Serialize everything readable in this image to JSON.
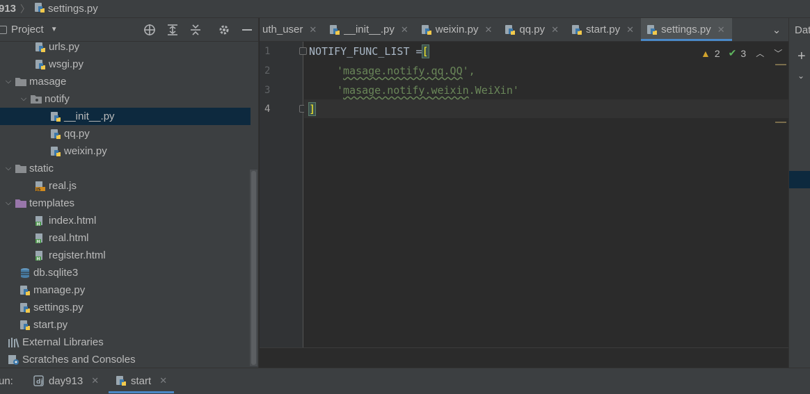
{
  "breadcrumb": {
    "root": "913",
    "file": "settings.py"
  },
  "project_panel": {
    "title": "Project",
    "tools": [
      "locate-icon",
      "expand-all-icon",
      "collapse-all-icon",
      "gear-icon",
      "minimize-icon"
    ]
  },
  "tree": [
    {
      "label": "urls.py",
      "icon": "python-file",
      "depth": 2,
      "expanded": null
    },
    {
      "label": "wsgi.py",
      "icon": "python-file",
      "depth": 2,
      "expanded": null
    },
    {
      "label": "masage",
      "icon": "folder",
      "depth": 1,
      "expanded": true
    },
    {
      "label": "notify",
      "icon": "package-folder",
      "depth": 2,
      "expanded": true
    },
    {
      "label": "__init__.py",
      "icon": "python-file",
      "depth": 3,
      "expanded": null,
      "selected": true
    },
    {
      "label": "qq.py",
      "icon": "python-file",
      "depth": 3,
      "expanded": null
    },
    {
      "label": "weixin.py",
      "icon": "python-file",
      "depth": 3,
      "expanded": null
    },
    {
      "label": "static",
      "icon": "folder",
      "depth": 1,
      "expanded": true
    },
    {
      "label": "real.js",
      "icon": "js-file",
      "depth": 2,
      "expanded": null
    },
    {
      "label": "templates",
      "icon": "template-folder",
      "depth": 1,
      "expanded": true
    },
    {
      "label": "index.html",
      "icon": "html-file",
      "depth": 2,
      "expanded": null
    },
    {
      "label": "real.html",
      "icon": "html-file",
      "depth": 2,
      "expanded": null
    },
    {
      "label": "register.html",
      "icon": "html-file",
      "depth": 2,
      "expanded": null
    },
    {
      "label": "db.sqlite3",
      "icon": "database",
      "depth": 1,
      "expanded": null
    },
    {
      "label": "manage.py",
      "icon": "python-file",
      "depth": 1,
      "expanded": null
    },
    {
      "label": "settings.py",
      "icon": "python-file",
      "depth": 1,
      "expanded": null
    },
    {
      "label": "start.py",
      "icon": "python-file",
      "depth": 1,
      "expanded": null
    },
    {
      "label": "External Libraries",
      "icon": "libraries",
      "depth": 0,
      "expanded": null
    },
    {
      "label": "Scratches and Consoles",
      "icon": "scratches",
      "depth": 0,
      "expanded": null
    }
  ],
  "tabs": [
    {
      "label": "uth_user",
      "icon": "none",
      "active": false
    },
    {
      "label": "__init__.py",
      "icon": "python-file",
      "active": false
    },
    {
      "label": "weixin.py",
      "icon": "python-file",
      "active": false
    },
    {
      "label": "qq.py",
      "icon": "python-file",
      "active": false
    },
    {
      "label": "start.py",
      "icon": "python-file",
      "active": false
    },
    {
      "label": "settings.py",
      "icon": "python-file",
      "active": true
    }
  ],
  "right_strip": {
    "label": "Dat"
  },
  "editor": {
    "line_numbers": [
      "1",
      "2",
      "3",
      "4"
    ],
    "line1_ident": "NOTIFY_FUNC_LIST =",
    "line1_bracket": "[",
    "line2_quote_open": "'",
    "line2_body": "masage.notify.qq.QQ",
    "line2_tail": "',",
    "line3_quote_open": "'",
    "line3_pre": "masage.notify.",
    "line3_wavy": "weixin",
    "line3_post": ".WeiXin",
    "line3_quote_close": "'",
    "line4_bracket": "]",
    "inspection": {
      "warnings": "2",
      "ok": "3"
    }
  },
  "run_bar": {
    "label": "un:",
    "tabs": [
      {
        "label": "day913",
        "icon": "django-icon",
        "active": false
      },
      {
        "label": "start",
        "icon": "python-file",
        "active": true
      }
    ]
  },
  "colors": {
    "accent": "#4a88c7",
    "selection": "#0d293e",
    "string": "#6a8759",
    "bracket_match": "#ffef28"
  }
}
